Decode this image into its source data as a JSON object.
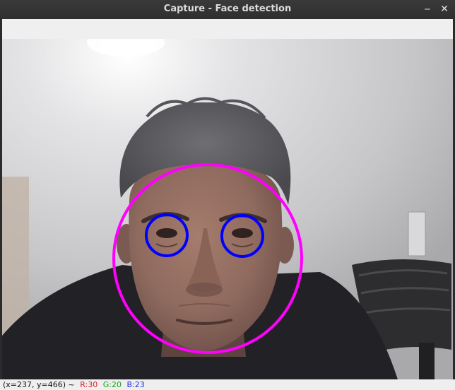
{
  "window": {
    "title": "Capture - Face detection",
    "minimize_glyph": "‒",
    "close_glyph": "✕"
  },
  "status": {
    "coords": "(x=237, y=466) ~",
    "r": "R:30",
    "g": "G:20",
    "b": "B:23"
  },
  "detections": {
    "face_circle_color": "#ff00ff",
    "eye_circle_color": "#0000ff"
  },
  "colors": {
    "r_label": "#e02020",
    "g_label": "#16a316",
    "b_label": "#1a2fe0"
  }
}
